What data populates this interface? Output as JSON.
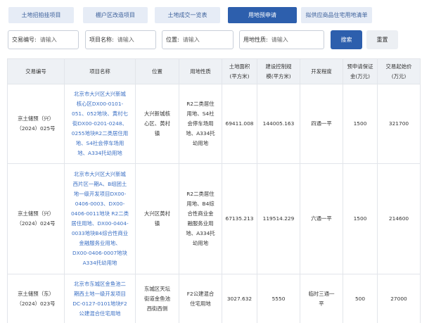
{
  "tabs": [
    {
      "label": "土地招拍挂项目"
    },
    {
      "label": "棚户区改造项目"
    },
    {
      "label": "土地成交一览表"
    },
    {
      "label": "用地预申请"
    },
    {
      "label": "拟供应商品住宅用地清单"
    }
  ],
  "filters": {
    "trade_no": {
      "label": "交易编号:",
      "placeholder": "请输入"
    },
    "project_name": {
      "label": "项目名称:",
      "placeholder": "请输入"
    },
    "location": {
      "label": "位置:",
      "placeholder": "请输入"
    },
    "land_use": {
      "label": "用地性质:",
      "placeholder": "请输入"
    },
    "search_label": "搜索",
    "reset_label": "重置"
  },
  "table": {
    "headers": {
      "trade_no": "交易编号",
      "project_name": "项目名称",
      "location": "位置",
      "land_use": "用地性质",
      "area_l1": "土地面积",
      "area_l2": "(平方米)",
      "building_l1": "建设控制规",
      "building_l2": "模(平方米)",
      "dev_level": "开发程度",
      "deposit_l1": "预申请保证",
      "deposit_l2": "金(万元)",
      "price_l1": "交易起始价",
      "price_l2": "(万元)"
    },
    "rows": [
      {
        "trade_no_l1": "京土储预（兴）",
        "trade_no_l2": "（2024）025号",
        "project_lines": [
          "北京市大兴区大兴新城",
          "核心区DX00-0101-",
          "051、052地块、黄村七",
          "街DX00-0201-0248、",
          "0255地块R2二类居住用",
          "地、S4社会停车场用",
          "地、A334托幼用地"
        ],
        "location_lines": [
          "大兴新城核",
          "心区、黄村",
          "镇"
        ],
        "land_use_lines": [
          "R2二类居住",
          "用地、S4社",
          "会停车场用",
          "地、A334托",
          "幼用地"
        ],
        "area": "69411.008",
        "building": "144005.163",
        "dev_level": "四通一平",
        "deposit": "1500",
        "price": "321700"
      },
      {
        "trade_no_l1": "京土储预（兴）",
        "trade_no_l2": "（2024）024号",
        "project_lines": [
          "北京市大兴区大兴新城",
          "西片区一期A、B组团土",
          "地一级开发项目DX00-",
          "0406-0003、DX00-",
          "0406-0011地块 R2二类",
          "居住用地、DX00-0404-",
          "0033地块B4综合性商业",
          "金融服务业用地、",
          "DX00-0406-0007地块",
          "A334托幼用地"
        ],
        "location_lines": [
          "大兴区黄村",
          "镇"
        ],
        "land_use_lines": [
          "R2二类居住",
          "用地、B4综",
          "合性商业金",
          "融服务业用",
          "地、A334托",
          "幼用地"
        ],
        "area": "67135.213",
        "building": "119514.229",
        "dev_level": "六通一平",
        "deposit": "1500",
        "price": "214600"
      },
      {
        "trade_no_l1": "京土储预（东）",
        "trade_no_l2": "（2024）023号",
        "project_lines": [
          "北京市东城区金鱼池二",
          "期西土地一级开发项目",
          "DC-0127-0101地块F2",
          "公建混合住宅用地"
        ],
        "location_lines": [
          "东城区天坛",
          "街道金鱼池",
          "西街西侧"
        ],
        "land_use_lines": [
          "F2公建混合",
          "住宅用地"
        ],
        "area": "3027.632",
        "building": "5550",
        "dev_level_lines": [
          "临时三通一",
          "平"
        ],
        "deposit": "500",
        "price": "27000"
      }
    ]
  }
}
